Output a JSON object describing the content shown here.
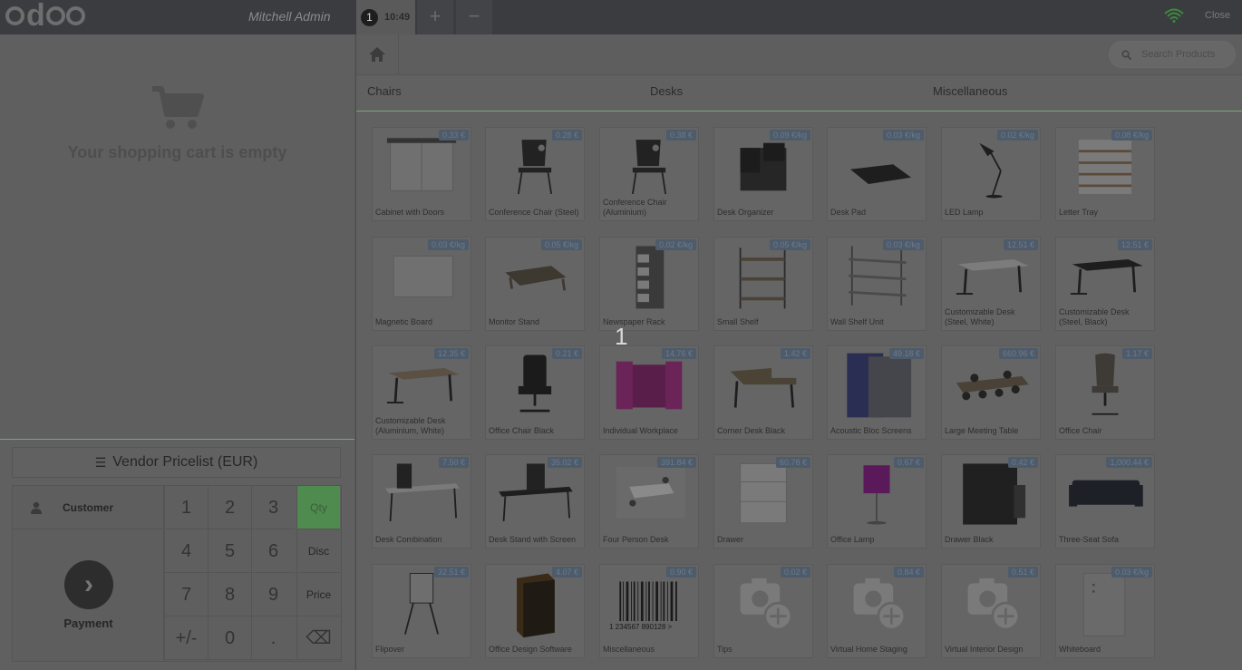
{
  "topbar": {
    "logo": "odoo",
    "cashier": "Mitchell Admin",
    "order": {
      "number": "1",
      "time": "10:49"
    },
    "add_label": "+",
    "remove_label": "−",
    "close_label": "Close"
  },
  "cart": {
    "empty_text": "Your shopping cart is empty"
  },
  "pricelist": {
    "label": "Vendor Pricelist (EUR)"
  },
  "actionpad": {
    "customer_label": "Customer",
    "payment_label": "Payment",
    "payment_icon": "›"
  },
  "numpad": {
    "keys": [
      "1",
      "2",
      "3",
      "4",
      "5",
      "6",
      "7",
      "8",
      "9",
      "+/-",
      "0",
      "."
    ],
    "modes": [
      "Qty",
      "Disc",
      "Price"
    ],
    "backspace": "⌫"
  },
  "search": {
    "placeholder": "Search Products"
  },
  "categories": [
    "Chairs",
    "Desks",
    "Miscellaneous"
  ],
  "toast": "1",
  "products": [
    {
      "name": "Cabinet with Doors",
      "price": "0.33 €"
    },
    {
      "name": "Conference Chair (Steel)",
      "price": "0.28 €"
    },
    {
      "name": "Conference Chair (Aluminium)",
      "price": "0.38 €"
    },
    {
      "name": "Desk Organizer",
      "price": "0.09 €/kg"
    },
    {
      "name": "Desk Pad",
      "price": "0.03 €/kg"
    },
    {
      "name": "LED Lamp",
      "price": "0.02 €/kg"
    },
    {
      "name": "Letter Tray",
      "price": "0.08 €/kg"
    },
    {
      "name": "Magnetic Board",
      "price": "0.03 €/kg"
    },
    {
      "name": "Monitor Stand",
      "price": "0.05 €/kg"
    },
    {
      "name": "Newspaper Rack",
      "price": "0.02 €/kg"
    },
    {
      "name": "Small Shelf",
      "price": "0.05 €/kg"
    },
    {
      "name": "Wall Shelf Unit",
      "price": "0.03 €/kg"
    },
    {
      "name": "Customizable Desk (Steel, White)",
      "price": "12.51 €"
    },
    {
      "name": "Customizable Desk (Steel, Black)",
      "price": "12.51 €"
    },
    {
      "name": "Customizable Desk (Aluminium, White)",
      "price": "12.35 €"
    },
    {
      "name": "Office Chair Black",
      "price": "0.21 €"
    },
    {
      "name": "Individual Workplace",
      "price": "14.76 €"
    },
    {
      "name": "Corner Desk Black",
      "price": "1.42 €"
    },
    {
      "name": "Acoustic Bloc Screens",
      "price": "49.18 €"
    },
    {
      "name": "Large Meeting Table",
      "price": "660.96 €"
    },
    {
      "name": "Office Chair",
      "price": "1.17 €"
    },
    {
      "name": "Desk Combination",
      "price": "7.50 €"
    },
    {
      "name": "Desk Stand with Screen",
      "price": "35.02 €"
    },
    {
      "name": "Four Person Desk",
      "price": "391.84 €"
    },
    {
      "name": "Drawer",
      "price": "60.78 €"
    },
    {
      "name": "Office Lamp",
      "price": "0.67 €"
    },
    {
      "name": "Drawer Black",
      "price": "0.42 €"
    },
    {
      "name": "Three-Seat Sofa",
      "price": "1,000.44 €"
    },
    {
      "name": "Flipover",
      "price": "32.51 €"
    },
    {
      "name": "Office Design Software",
      "price": "4.07 €"
    },
    {
      "name": "Miscellaneous",
      "price": "0.90 €"
    },
    {
      "name": "Tips",
      "price": "0.02 €"
    },
    {
      "name": "Virtual Home Staging",
      "price": "0.84 €"
    },
    {
      "name": "Virtual Interior Design",
      "price": "0.51 €"
    },
    {
      "name": "Whiteboard",
      "price": "0.03 €/kg"
    }
  ],
  "barcode_text": "1 234567 890128 >"
}
